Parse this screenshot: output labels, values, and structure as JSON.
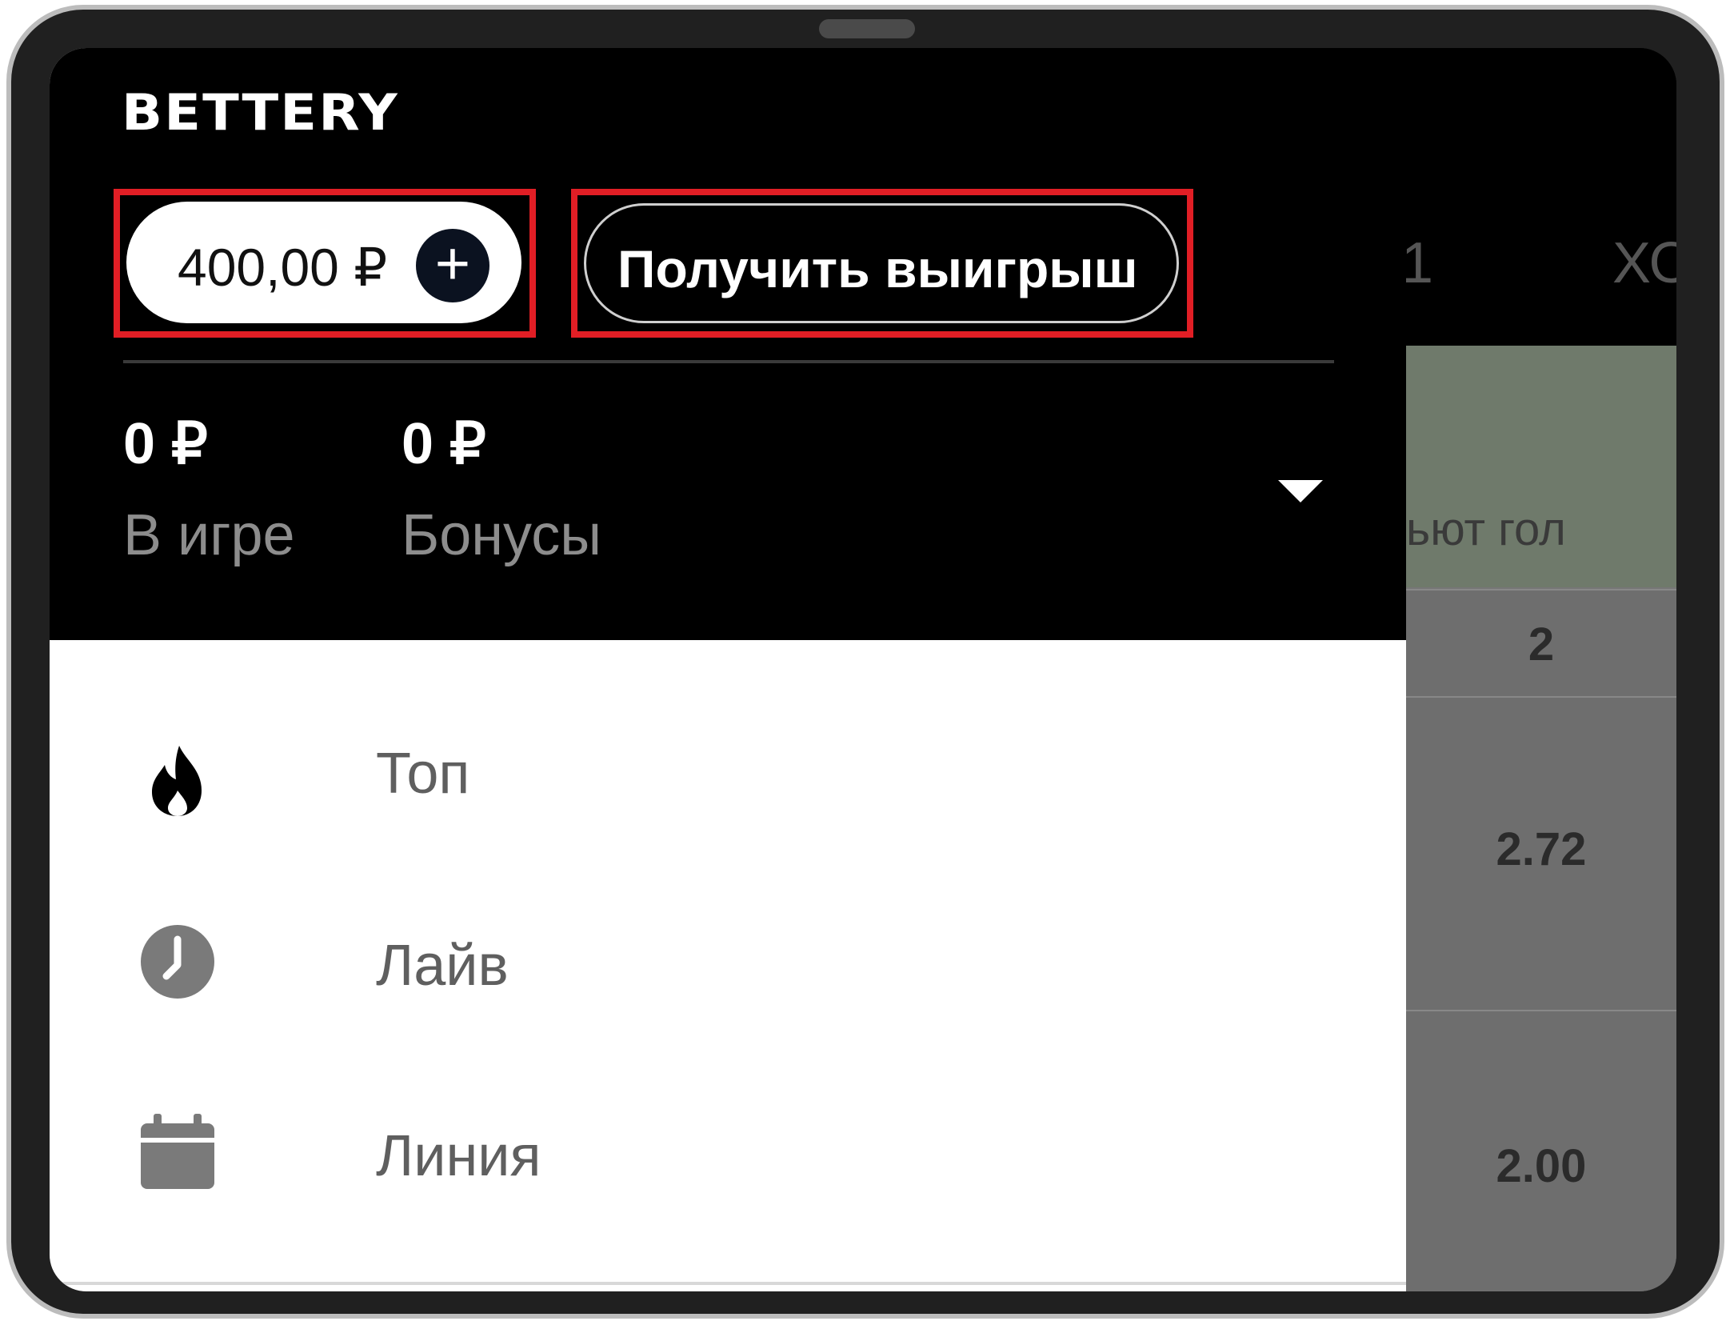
{
  "brand": {
    "logo": "BETTERY"
  },
  "header": {
    "balance": "400,00 ₽",
    "deposit_button_symbol": "+",
    "withdraw_label": "Получить выигрыш"
  },
  "stats": [
    {
      "value": "0 ₽",
      "label": "В игре"
    },
    {
      "value": "0 ₽",
      "label": "Бонусы"
    }
  ],
  "menu": {
    "items": [
      {
        "label": "Топ",
        "icon": "fire-icon"
      },
      {
        "label": "Лайв",
        "icon": "clock-icon"
      },
      {
        "label": "Линия",
        "icon": "calendar-icon"
      }
    ]
  },
  "background": {
    "tabs": [
      "1",
      "ХО"
    ],
    "column_header": "ьют гол",
    "odds": [
      "2",
      "2.72",
      "2.00"
    ]
  },
  "colors": {
    "highlight": "#e11e25",
    "drawer_header": "#000000",
    "accent_button": "#0b1220"
  }
}
